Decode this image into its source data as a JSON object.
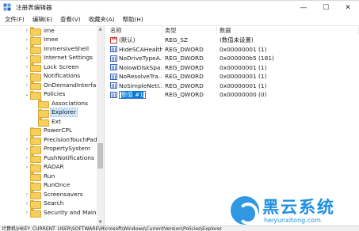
{
  "window": {
    "title": "注册表编辑器",
    "minimize_glyph": "—",
    "maximize_glyph": "☐",
    "close_glyph": "✕"
  },
  "menu": [
    "文件(F)",
    "编辑(E)",
    "查看(V)",
    "收藏夹(A)",
    "帮助(H)"
  ],
  "tree": {
    "items": [
      {
        "label": "ime",
        "expand": "›"
      },
      {
        "label": "Imee",
        "expand": "›"
      },
      {
        "label": "ImmersiveShell",
        "expand": "›"
      },
      {
        "label": "Internet Settings",
        "expand": "›"
      },
      {
        "label": "Lock Screen",
        "expand": "›"
      },
      {
        "label": "Notifications",
        "expand": "›"
      },
      {
        "label": "OnDemandInterfaceC",
        "expand": "›"
      },
      {
        "label": "Policies",
        "expand": "⌄"
      },
      {
        "label": "Associations",
        "expand": ""
      },
      {
        "label": "Explorer",
        "expand": ""
      },
      {
        "label": "Ext",
        "expand": ""
      },
      {
        "label": "PowerCPL",
        "expand": ""
      },
      {
        "label": "PrecisionTouchPad",
        "expand": "›"
      },
      {
        "label": "PropertySystem",
        "expand": "›"
      },
      {
        "label": "PushNotifications",
        "expand": "›"
      },
      {
        "label": "RADAR",
        "expand": "›"
      },
      {
        "label": "Run",
        "expand": ""
      },
      {
        "label": "RunOnce",
        "expand": ""
      },
      {
        "label": "Screensavers",
        "expand": "›"
      },
      {
        "label": "Search",
        "expand": "›"
      },
      {
        "label": "Security and Mainten",
        "expand": "›"
      }
    ],
    "selected": "Explorer",
    "scroll_up": "▲",
    "scroll_down": "▼"
  },
  "list": {
    "headers": {
      "name": "名称",
      "type": "类型",
      "data": "数据"
    },
    "rows": [
      {
        "name": "(默认)",
        "type": "REG_SZ",
        "data": "(数值未设置)",
        "icon": "string-value-icon"
      },
      {
        "name": "HideSCAHealth",
        "type": "REG_DWORD",
        "data": "0x00000001 (1)",
        "icon": "binary-value-icon"
      },
      {
        "name": "NoDriveTypeA...",
        "type": "REG_DWORD",
        "data": "0x000000b5 (181)",
        "icon": "binary-value-icon"
      },
      {
        "name": "NolowDiskSpa...",
        "type": "REG_DWORD",
        "data": "0x00000001 (1)",
        "icon": "binary-value-icon"
      },
      {
        "name": "NoResolveTra...",
        "type": "REG_DWORD",
        "data": "0x00000001 (1)",
        "icon": "binary-value-icon"
      },
      {
        "name": "NoSimpleNetI...",
        "type": "REG_DWORD",
        "data": "0x00000001 (1)",
        "icon": "binary-value-icon"
      },
      {
        "name": "新值 #1",
        "type": "REG_QWORD",
        "data": "0x00000000 (0)",
        "icon": "binary-value-icon",
        "editing": true
      }
    ]
  },
  "statusbar": {
    "path": "计算机\\HKEY_CURRENT_USER\\SOFTWARE\\Microsoft\\Windows\\CurrentVersion\\Policies\\Explorer"
  },
  "watermark": {
    "title": "黑云系统",
    "url": "heiyunxitong.com"
  },
  "colors": {
    "selection": "#cce8ff",
    "edit_highlight": "#0078d7",
    "watermark": "#1f8fe0"
  }
}
